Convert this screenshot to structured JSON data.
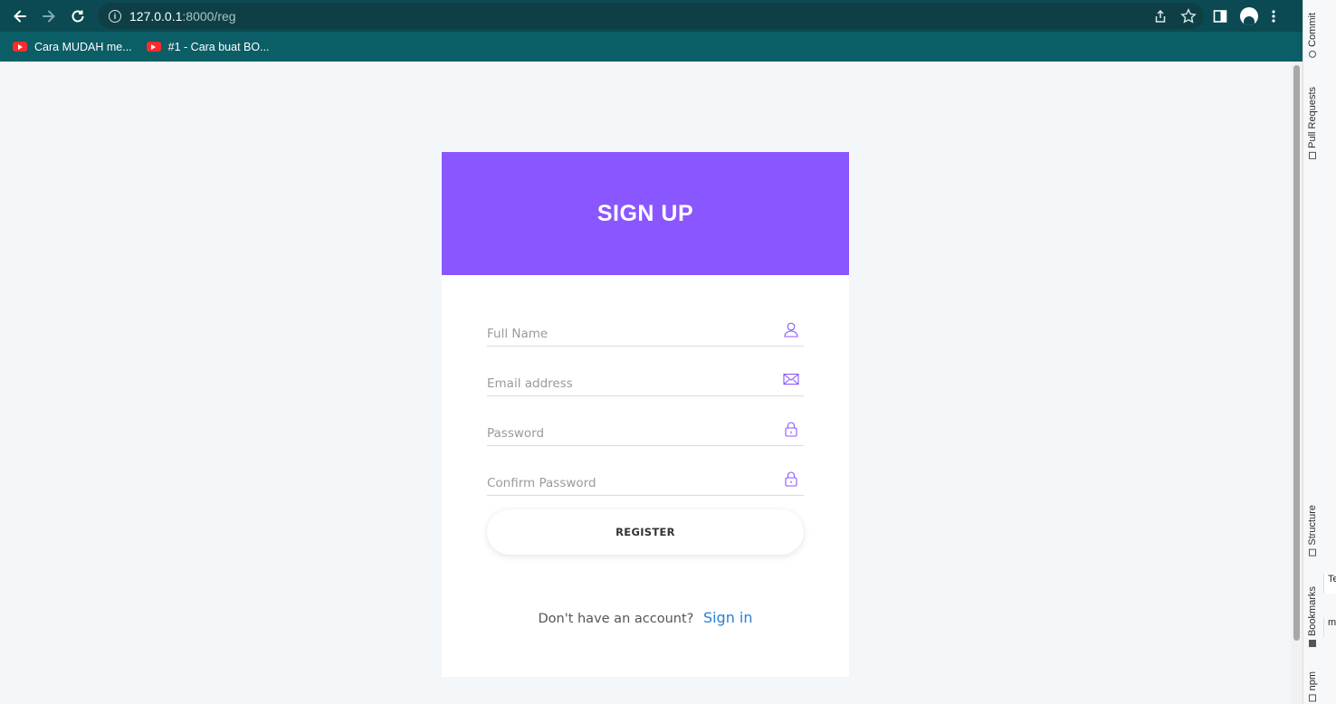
{
  "browser": {
    "url_host": "127.0.0.1",
    "url_rest": ":8000/reg",
    "bookmarks": [
      {
        "label": "Cara MUDAH me..."
      },
      {
        "label": "#1 - Cara buat BO..."
      }
    ]
  },
  "page": {
    "title": "SIGN UP",
    "fields": {
      "full_name": {
        "placeholder": "Full Name",
        "icon": "user-icon"
      },
      "email": {
        "placeholder": "Email address",
        "icon": "mail-icon"
      },
      "password": {
        "placeholder": "Password",
        "icon": "lock-icon"
      },
      "confirm_password": {
        "placeholder": "Confirm Password",
        "icon": "lock-icon"
      }
    },
    "register_label": "REGISTER",
    "footer_text": "Don't have an account?",
    "signin_link": "Sign in"
  },
  "ide_panel": {
    "tabs": [
      "Commit",
      "Pull Requests",
      "Structure",
      "Bookmarks",
      "npm"
    ],
    "fragments": [
      "Te",
      "ma"
    ]
  },
  "colors": {
    "header_purple": "#8a56ff",
    "toolbar_teal": "#0b4a52",
    "bookmarks_teal": "#0b5d66",
    "link_blue": "#2a7fd4",
    "page_bg": "#f3f7fa"
  }
}
